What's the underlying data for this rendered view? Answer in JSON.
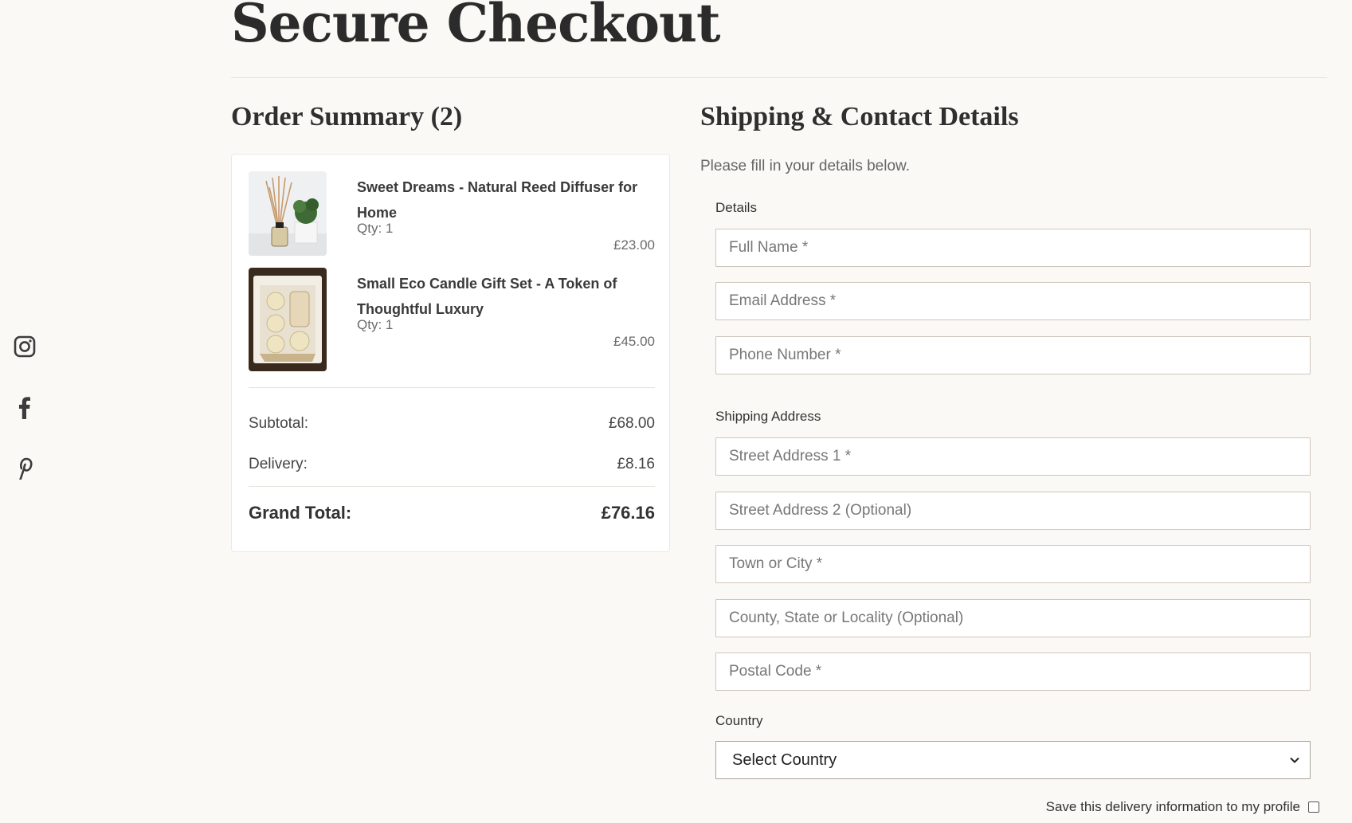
{
  "page": {
    "title": "Secure Checkout"
  },
  "social": {
    "icons": [
      "instagram-icon",
      "facebook-icon",
      "pinterest-icon"
    ]
  },
  "order_summary": {
    "title": "Order Summary (2)",
    "items": [
      {
        "name": "Sweet Dreams - Natural Reed Diffuser for Home",
        "qty": "Qty: 1",
        "price": "£23.00"
      },
      {
        "name": "Small Eco Candle Gift Set - A Token of Thoughtful Luxury",
        "qty": "Qty: 1",
        "price": "£45.00"
      }
    ],
    "subtotal_label": "Subtotal:",
    "subtotal": "£68.00",
    "delivery_label": "Delivery:",
    "delivery": "£8.16",
    "grand_label": "Grand Total:",
    "grand": "£76.16"
  },
  "shipping": {
    "title": "Shipping & Contact Details",
    "lead": "Please fill in your details below.",
    "details_label": "Details",
    "full_name_ph": "Full Name *",
    "email_ph": "Email Address *",
    "phone_ph": "Phone Number *",
    "address_label": "Shipping Address",
    "street1_ph": "Street Address 1 *",
    "street2_ph": "Street Address 2 (Optional)",
    "town_ph": "Town or City *",
    "county_ph": "County, State or Locality (Optional)",
    "postal_ph": "Postal Code *",
    "country_label": "Country",
    "country_value": "Select Country",
    "save_label": "Save this delivery information to my profile"
  },
  "colors": {
    "background": "#faf9f6",
    "border": "#cfc6bb",
    "text": "#333333"
  }
}
